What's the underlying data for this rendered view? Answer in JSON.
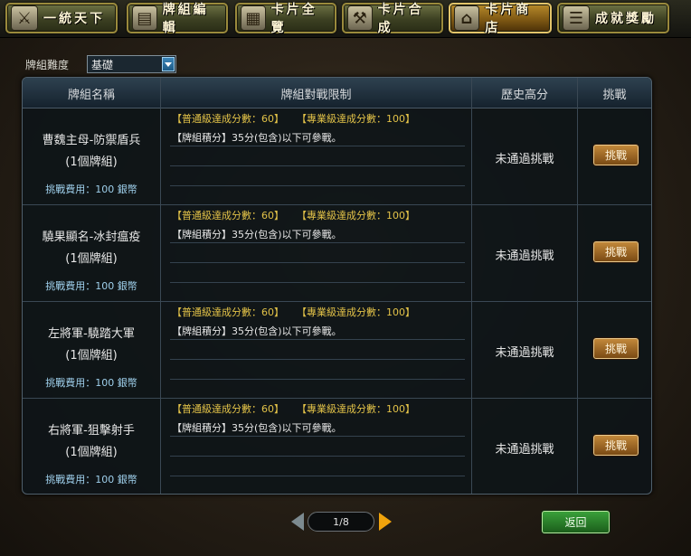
{
  "nav": [
    {
      "label": "一統天下",
      "icon": "crossed-swords-icon",
      "glyph": "⚔"
    },
    {
      "label": "牌組編輯",
      "icon": "card-deck-icon",
      "glyph": "▤"
    },
    {
      "label": "卡片全覽",
      "icon": "card-view-icon",
      "glyph": "▦"
    },
    {
      "label": "卡片合成",
      "icon": "hammer-icon",
      "glyph": "⚒"
    },
    {
      "label": "卡片商店",
      "icon": "shop-icon",
      "glyph": "⌂"
    },
    {
      "label": "成就獎勵",
      "icon": "scroll-icon",
      "glyph": "☰"
    }
  ],
  "difficulty": {
    "label": "牌組難度",
    "selected": "基礎"
  },
  "table": {
    "headers": {
      "name": "牌組名稱",
      "limit": "牌組對戰限制",
      "high_score": "歷史高分",
      "challenge": "挑戰"
    },
    "rows": [
      {
        "name": "曹魏主母-防禦盾兵",
        "count": "(1個牌組)",
        "fee": "挑戰費用：100 銀幣",
        "score_req": "【普通級達成分數：60】    【專業級達成分數：100】",
        "rule": "【牌組積分】35分(包含)以下可參戰。",
        "high_score": "未通過挑戰",
        "button": "挑戰"
      },
      {
        "name": "驍果顯名-冰封瘟疫",
        "count": "(1個牌組)",
        "fee": "挑戰費用：100 銀幣",
        "score_req": "【普通級達成分數：60】    【專業級達成分數：100】",
        "rule": "【牌組積分】35分(包含)以下可參戰。",
        "high_score": "未通過挑戰",
        "button": "挑戰"
      },
      {
        "name": "左將軍-驍踏大軍",
        "count": "(1個牌組)",
        "fee": "挑戰費用：100 銀幣",
        "score_req": "【普通級達成分數：60】    【專業級達成分數：100】",
        "rule": "【牌組積分】35分(包含)以下可參戰。",
        "high_score": "未通過挑戰",
        "button": "挑戰"
      },
      {
        "name": "右將軍-狙擊射手",
        "count": "(1個牌組)",
        "fee": "挑戰費用：100 銀幣",
        "score_req": "【普通級達成分數：60】    【專業級達成分數：100】",
        "rule": "【牌組積分】35分(包含)以下可參戰。",
        "high_score": "未通過挑戰",
        "button": "挑戰"
      }
    ]
  },
  "pager": {
    "text": "1/8"
  },
  "back_label": "返回"
}
